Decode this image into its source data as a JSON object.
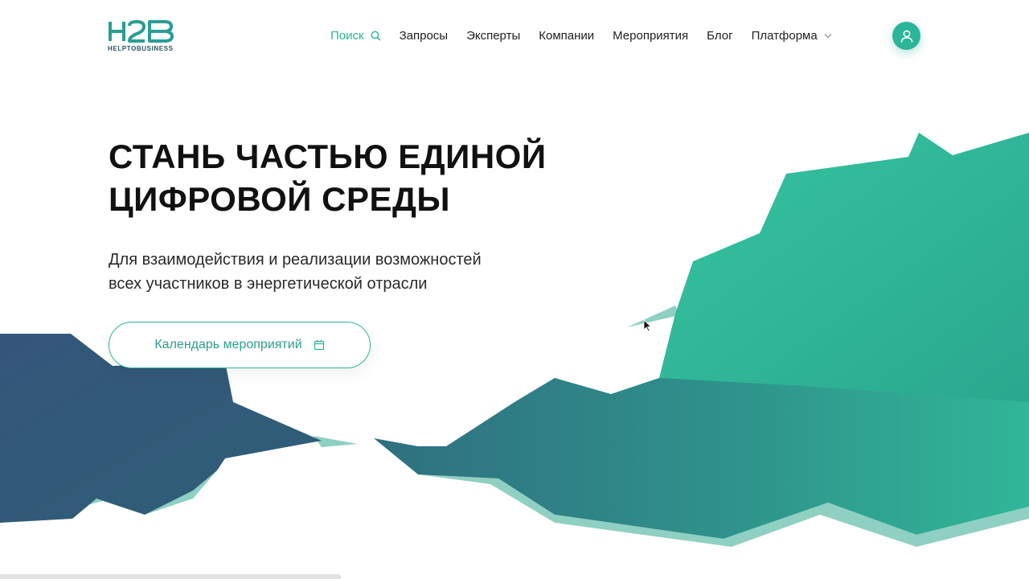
{
  "header": {
    "logo_text": "H2B",
    "logo_subtitle": "HELPTOBUSINESS",
    "nav": [
      {
        "label": "Поиск",
        "icon": "search-icon",
        "active": true
      },
      {
        "label": "Запросы"
      },
      {
        "label": "Эксперты"
      },
      {
        "label": "Компании"
      },
      {
        "label": "Мероприятия"
      },
      {
        "label": "Блог"
      },
      {
        "label": "Платформа",
        "icon": "chevron-down-icon"
      }
    ],
    "profile_icon": "user-icon"
  },
  "hero": {
    "title_line1": "СТАНЬ ЧАСТЬЮ ЕДИНОЙ",
    "title_line2": "ЦИФРОВОЙ СРЕДЫ",
    "subtitle_line1": "Для взаимодействия и реализации возможностей",
    "subtitle_line2": "всех участников в энергетической отрасли",
    "cta_label": "Календарь мероприятий",
    "cta_icon": "calendar-icon"
  },
  "colors": {
    "accent": "#2bb59a",
    "dark_blue": "#33536f",
    "teal": "#2d8a8a"
  }
}
